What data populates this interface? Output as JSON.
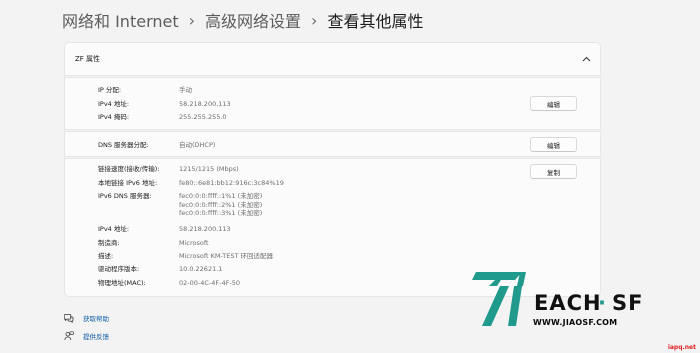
{
  "breadcrumb": {
    "items": [
      "网络和 Internet",
      "高级网络设置",
      "查看其他属性"
    ],
    "separator": "›"
  },
  "card": {
    "title": "ZF 属性"
  },
  "section1": {
    "rows": [
      {
        "key": "IP 分配:",
        "value": "手动"
      },
      {
        "key": "IPv4 地址:",
        "value": "58.218.200.113"
      },
      {
        "key": "IPv4 掩码:",
        "value": "255.255.255.0"
      }
    ],
    "button_label": "编辑"
  },
  "section2": {
    "rows": [
      {
        "key": "DNS 服务器分配:",
        "value": "自动(DHCP)"
      }
    ],
    "button_label": "编辑"
  },
  "section3": {
    "button_label": "复制",
    "link_speed": {
      "key": "链接速度(接收/传输):",
      "value": "1215/1215 (Mbps)"
    },
    "ipv6_local": {
      "key": "本地链接 IPv6 地址:",
      "value": "fe80::6e81:bb12:916c:3c84%19"
    },
    "ipv6_dns": {
      "key": "IPv6 DNS 服务器:",
      "values": [
        "fec0:0:0:ffff::1%1 (未加密)",
        "fec0:0:0:ffff::2%1 (未加密)",
        "fec0:0:0:ffff::3%1 (未加密)"
      ]
    },
    "ipv4": {
      "key": "IPv4 地址:",
      "value": "58.218.200.113"
    },
    "manufacturer": {
      "key": "制造商:",
      "value": "Microsoft"
    },
    "description": {
      "key": "描述:",
      "value": "Microsoft KM-TEST 环回适配器"
    },
    "driver": {
      "key": "驱动程序版本:",
      "value": "10.0.22621.1"
    },
    "mac": {
      "key": "物理地址(MAC):",
      "value": "02-00-4C-4F-4F-50"
    }
  },
  "footer_links": {
    "help": "获取帮助",
    "feedback": "提供反馈"
  },
  "watermark": {
    "logo_text": "TEACH·SF",
    "url": "WWW.JIAOSF.COM",
    "corner": "iapq.net",
    "brand_color": "#1f9a8c"
  },
  "icons": {
    "collapse": "chevron-up-icon",
    "help": "help-chat-icon",
    "feedback": "feedback-person-icon"
  }
}
